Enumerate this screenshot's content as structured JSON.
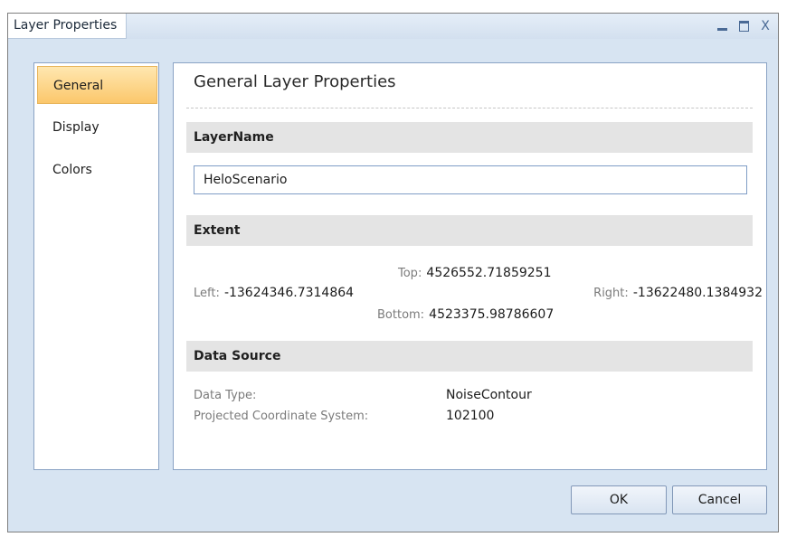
{
  "window": {
    "title": "Layer Properties",
    "controls": {
      "minimize_icon": "minimize-icon",
      "maximize_icon": "maximize-icon",
      "close_glyph": "X"
    }
  },
  "nav": {
    "items": [
      {
        "label": "General",
        "selected": true
      },
      {
        "label": "Display",
        "selected": false
      },
      {
        "label": "Colors",
        "selected": false
      }
    ]
  },
  "panel": {
    "title": "General Layer Properties",
    "layer_name": {
      "header": "LayerName",
      "value": "HeloScenario"
    },
    "extent": {
      "header": "Extent",
      "top_label": "Top:",
      "top_value": "4526552.71859251",
      "left_label": "Left:",
      "left_value": "-13624346.7314864",
      "right_label": "Right:",
      "right_value": "-13622480.1384932",
      "bottom_label": "Bottom:",
      "bottom_value": "4523375.98786607"
    },
    "data_source": {
      "header": "Data Source",
      "rows": [
        {
          "label": "Data Type:",
          "value": "NoiseContour"
        },
        {
          "label": "Projected Coordinate System:",
          "value": "102100"
        }
      ]
    }
  },
  "buttons": {
    "ok": "OK",
    "cancel": "Cancel"
  },
  "colors": {
    "accent_selected": "#fbc76b",
    "window_bg": "#d7e4f2",
    "section_bg": "#e4e4e4"
  }
}
